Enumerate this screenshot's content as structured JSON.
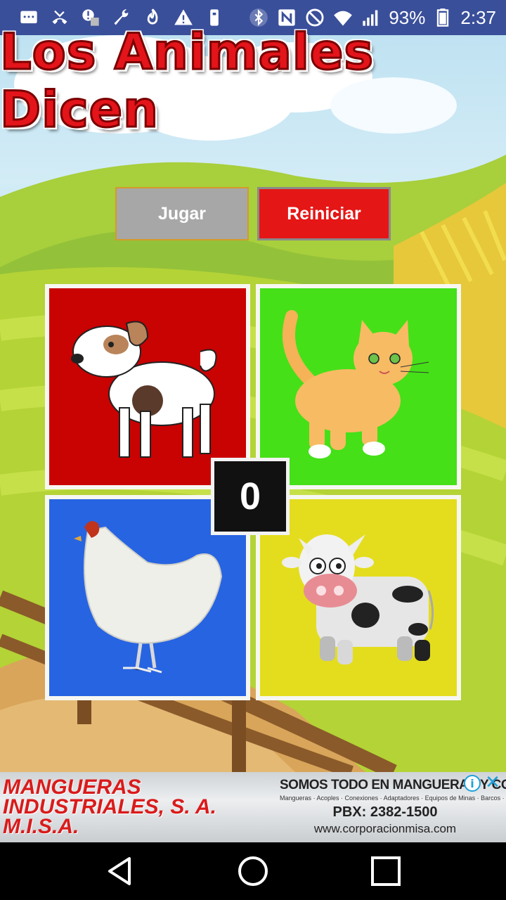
{
  "status_bar": {
    "left_icons": [
      "message-icon",
      "missed-call-icon",
      "alert-app-icon",
      "wrench-icon",
      "flame-icon",
      "warning-icon",
      "usb-icon"
    ],
    "right_icons": [
      "bluetooth-icon",
      "nfc-icon",
      "do-not-disturb-icon",
      "wifi-icon",
      "signal-icon"
    ],
    "battery": "93%",
    "time": "2:37"
  },
  "app": {
    "title": "Los Animales Dicen",
    "play_button": "Jugar",
    "reset_button": "Reiniciar",
    "score": "0",
    "tiles": [
      {
        "animal": "dog",
        "color": "#c90202"
      },
      {
        "animal": "cat",
        "color": "#45e018"
      },
      {
        "animal": "hen",
        "color": "#2764e2"
      },
      {
        "animal": "cow",
        "color": "#e4dd1e"
      }
    ]
  },
  "ad": {
    "left_text": "MANGUERAS INDUSTRIALES, S. A. M.I.S.A.",
    "headline": "SOMOS TODO EN MANGUERAS Y CONE",
    "subline": "Mangueras · Acoples · Conexiones · Adaptadores · Equipos de Minas · Barcos · Transporte",
    "phone": "PBX: 2382-1500",
    "url": "www.corporacionmisa.com",
    "info_glyph": "i",
    "close_glyph": "✕"
  },
  "navbar": {
    "back": "back-icon",
    "home": "home-icon",
    "recents": "recents-icon"
  },
  "colors": {
    "status_bar": "#3a4f9a",
    "title_red": "#e3141a",
    "play_gray": "#a7a7a7",
    "reset_red": "#e51616"
  }
}
